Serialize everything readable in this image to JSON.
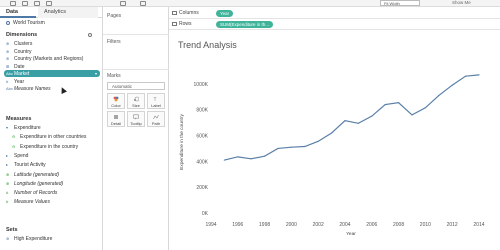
{
  "toolbar": {
    "dropdown": "Fit Width",
    "show_me": "Show Me"
  },
  "left_pane": {
    "tabs": [
      "Data",
      "Analytics"
    ],
    "datasource": "World Tourism",
    "dimensions_header": "Dimensions",
    "dimensions": [
      {
        "icon": "⊕",
        "label": "Clusters",
        "italic": false,
        "selected": false
      },
      {
        "icon": "⊕",
        "label": "Country",
        "italic": false,
        "selected": false
      },
      {
        "icon": "⊕",
        "label": "Country (Markets and Regions)",
        "italic": false,
        "selected": false
      },
      {
        "icon": "⊞",
        "label": "Date",
        "italic": false,
        "selected": false
      },
      {
        "icon": "Abc",
        "label": "Market",
        "italic": false,
        "selected": true
      },
      {
        "icon": "#",
        "label": "Year",
        "italic": false,
        "selected": false
      },
      {
        "icon": "Abc",
        "label": "Measure Names",
        "italic": true,
        "selected": false
      }
    ],
    "measures_header": "Measures",
    "measures": [
      {
        "icon": "▾",
        "label": "Expenditure",
        "italic": false,
        "indent": 0
      },
      {
        "icon": "⊖",
        "label": "Expenditure in other countries",
        "italic": false,
        "indent": 1
      },
      {
        "icon": "⊖",
        "label": "Expenditure in the country",
        "italic": false,
        "indent": 1
      },
      {
        "icon": "▸",
        "label": "Spend",
        "italic": false,
        "indent": 0
      },
      {
        "icon": "▸",
        "label": "Tourist Activity",
        "italic": false,
        "indent": 0
      },
      {
        "icon": "⊕",
        "label": "Latitude (generated)",
        "italic": true,
        "indent": 0
      },
      {
        "icon": "⊕",
        "label": "Longitude (generated)",
        "italic": true,
        "indent": 0
      },
      {
        "icon": "#",
        "label": "Number of Records",
        "italic": true,
        "indent": 0
      },
      {
        "icon": "#",
        "label": "Measure Values",
        "italic": true,
        "indent": 0
      }
    ],
    "sets_header": "Sets",
    "sets": [
      {
        "icon": "⊚",
        "label": "High Expenditure"
      }
    ]
  },
  "middle_pane": {
    "pages": "Pages",
    "filters": "Filters",
    "marks": "Marks",
    "marks_type": "Automatic",
    "buttons": [
      "Color",
      "Size",
      "Label",
      "Detail",
      "Tooltip",
      "Path"
    ]
  },
  "shelves": {
    "columns_label": "Columns",
    "columns_pill": "Year",
    "rows_label": "Rows",
    "rows_pill": "SUM(Expenditure in th..."
  },
  "chart_data": {
    "type": "line",
    "title": "Trend Analysis",
    "xlabel": "Year",
    "ylabel": "Expenditure in the country",
    "x": [
      1995,
      1996,
      1997,
      1998,
      1999,
      2000,
      2001,
      2002,
      2003,
      2004,
      2005,
      2006,
      2007,
      2008,
      2009,
      2010,
      2011,
      2012,
      2013,
      2014
    ],
    "series": [
      {
        "values": [
          410000,
          435000,
          420000,
          440000,
          500000,
          510000,
          515000,
          555000,
          620000,
          715000,
          695000,
          750000,
          840000,
          855000,
          760000,
          815000,
          910000,
          990000,
          1060000,
          1070000
        ]
      }
    ],
    "xticks": [
      "1994",
      "1996",
      "1998",
      "2000",
      "2002",
      "2004",
      "2006",
      "2008",
      "2010",
      "2012",
      "2014"
    ],
    "yticks": [
      "0K",
      "200K",
      "400K",
      "600K",
      "800K",
      "1000K"
    ],
    "xlim": [
      1994,
      2014.6
    ],
    "ylim": [
      0,
      1100000
    ],
    "grid": false,
    "color": "#5a7fa8"
  }
}
